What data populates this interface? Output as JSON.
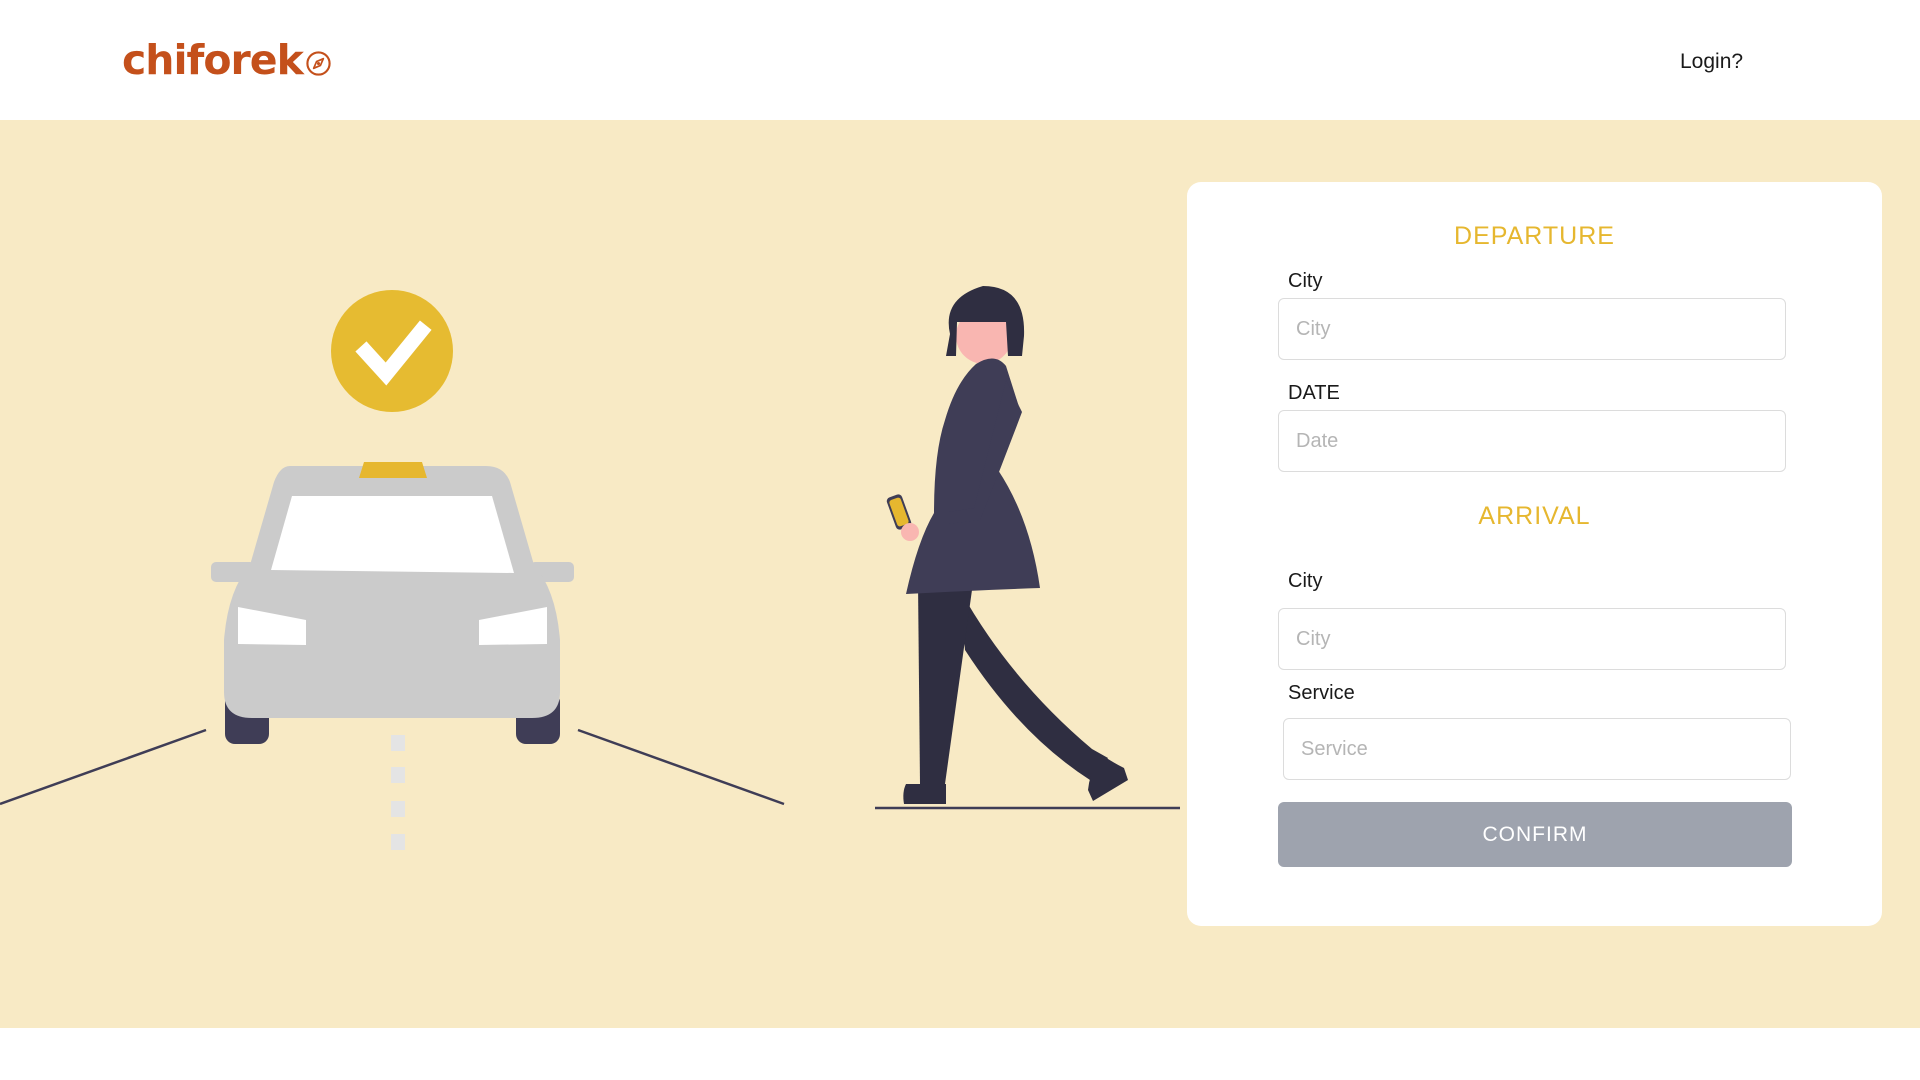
{
  "header": {
    "logo_text": "chiforek",
    "login_label": "Login?"
  },
  "icons": {
    "logo": "compass-icon",
    "check": "checkmark-icon"
  },
  "colors": {
    "brand": "#c4501b",
    "hero_background": "#f8eac5",
    "accent_yellow": "#e6b72f",
    "confirm_button": "#9ea3ae",
    "card_background": "#ffffff"
  },
  "form": {
    "departure": {
      "title": "DEPARTURE",
      "city_label": "City",
      "city_placeholder": "City",
      "date_label": "DATE",
      "date_placeholder": "Date"
    },
    "arrival": {
      "title": "ARRIVAL",
      "city_label": "City",
      "city_placeholder": "City",
      "service_label": "Service",
      "service_placeholder": "Service"
    },
    "confirm_label": "CONFIRM"
  }
}
